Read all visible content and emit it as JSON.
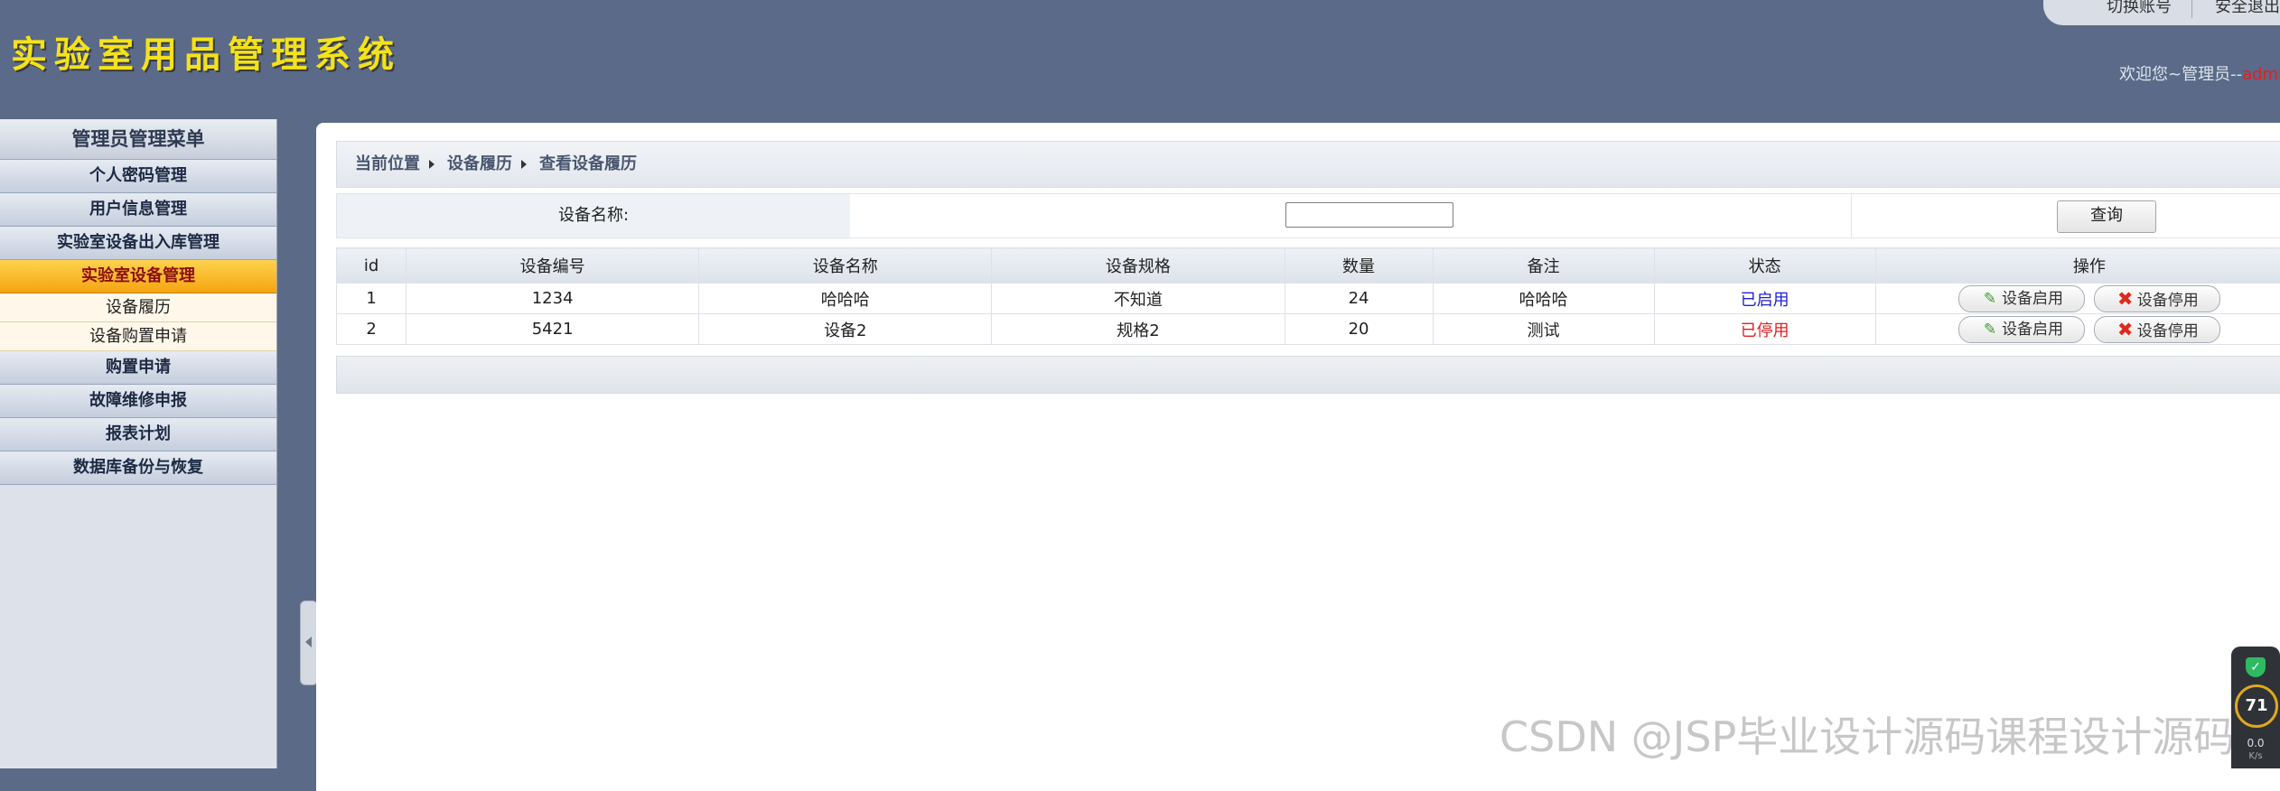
{
  "header": {
    "app_title": "实验室用品管理系统",
    "switch_account": "切换账号",
    "logout": "安全退出",
    "welcome_prefix": "欢迎您~管理员--",
    "welcome_user": "admin"
  },
  "sidebar": {
    "title": "管理员管理菜单",
    "items": [
      {
        "label": "个人密码管理"
      },
      {
        "label": "用户信息管理"
      },
      {
        "label": "实验室设备出入库管理"
      },
      {
        "label": "实验室设备管理",
        "active": true
      },
      {
        "label": "购置申请"
      },
      {
        "label": "故障维修申报"
      },
      {
        "label": "报表计划"
      },
      {
        "label": "数据库备份与恢复"
      }
    ],
    "submenu": [
      {
        "label": "设备履历"
      },
      {
        "label": "设备购置申请"
      }
    ]
  },
  "breadcrumb": {
    "items": [
      "当前位置",
      "设备履历",
      "查看设备履历"
    ]
  },
  "search": {
    "label": "设备名称:",
    "value": "",
    "button": "查询"
  },
  "table": {
    "columns": [
      "id",
      "设备编号",
      "设备名称",
      "设备规格",
      "数量",
      "备注",
      "状态",
      "操作"
    ],
    "rows": [
      {
        "id": "1",
        "code": "1234",
        "name": "哈哈哈",
        "spec": "不知道",
        "qty": "24",
        "note": "哈哈哈",
        "status": "已启用",
        "status_type": "enabled"
      },
      {
        "id": "2",
        "code": "5421",
        "name": "设备2",
        "spec": "规格2",
        "qty": "20",
        "note": "测试",
        "status": "已停用",
        "status_type": "disabled"
      }
    ],
    "actions": {
      "enable": "设备启用",
      "disable": "设备停用"
    },
    "status_colors": {
      "enabled": "#1f1fd0",
      "disabled": "#e01f1f"
    }
  },
  "watermark": "CSDN @JSP毕业设计源码课程设计源码",
  "widget": {
    "value": "71",
    "speed": "0.0",
    "unit": "K/s"
  }
}
